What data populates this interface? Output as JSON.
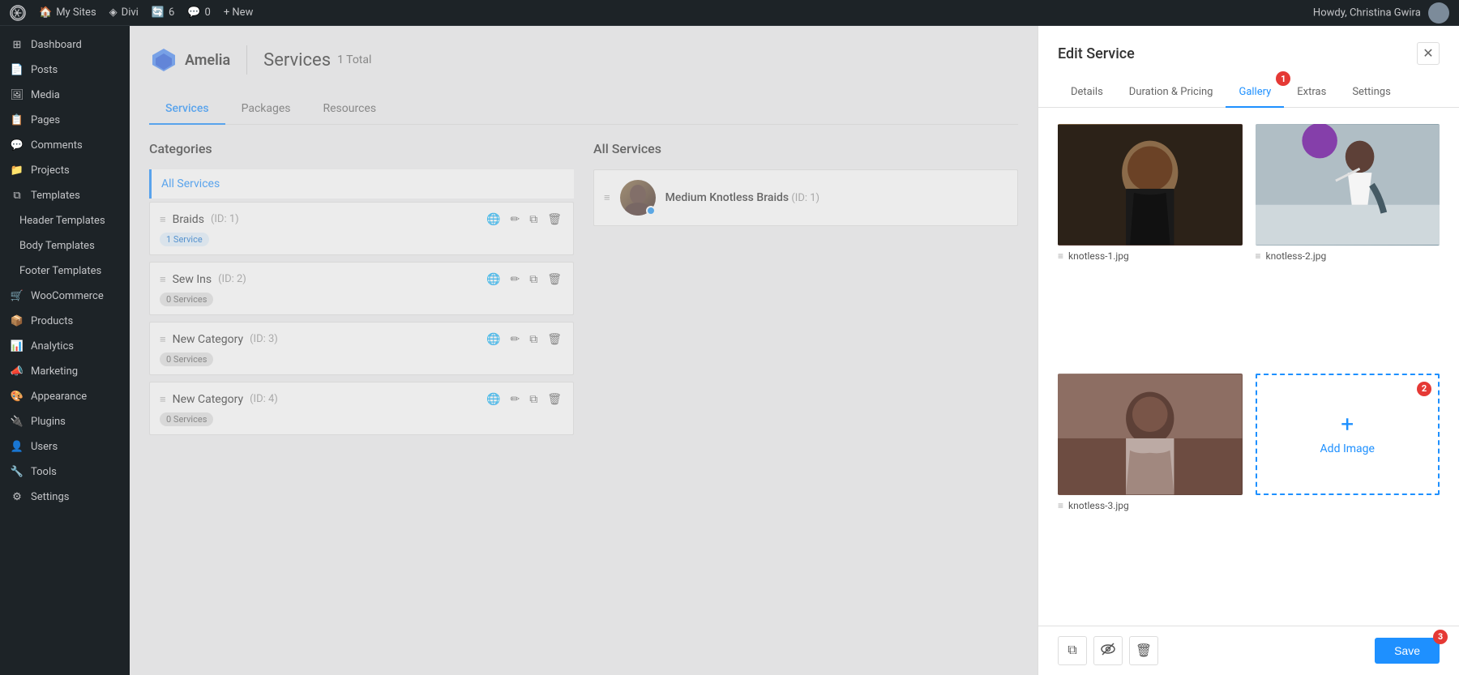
{
  "adminBar": {
    "wpIcon": "W",
    "mySites": "My Sites",
    "divi": "Divi",
    "updates": "6",
    "comments": "0",
    "new": "+ New",
    "greeting": "Howdy, Christina Gwira"
  },
  "sidebar": {
    "items": [
      {
        "id": "dashboard",
        "label": "Dashboard",
        "icon": "⊞"
      },
      {
        "id": "posts",
        "label": "Posts",
        "icon": "📄"
      },
      {
        "id": "media",
        "label": "Media",
        "icon": "🖼"
      },
      {
        "id": "pages",
        "label": "Pages",
        "icon": "📋"
      },
      {
        "id": "comments",
        "label": "Comments",
        "icon": "💬"
      },
      {
        "id": "projects",
        "label": "Projects",
        "icon": "📁"
      },
      {
        "id": "templates",
        "label": "Templates",
        "icon": "⧉"
      },
      {
        "id": "header-templates",
        "label": "Header Templates",
        "icon": ""
      },
      {
        "id": "body-templates",
        "label": "Body Templates",
        "icon": ""
      },
      {
        "id": "footer-templates",
        "label": "Footer Templates",
        "icon": ""
      },
      {
        "id": "woocommerce",
        "label": "WooCommerce",
        "icon": "🛒"
      },
      {
        "id": "products",
        "label": "Products",
        "icon": "📦"
      },
      {
        "id": "analytics",
        "label": "Analytics",
        "icon": "📊"
      },
      {
        "id": "marketing",
        "label": "Marketing",
        "icon": "📣"
      },
      {
        "id": "appearance",
        "label": "Appearance",
        "icon": "🎨"
      },
      {
        "id": "plugins",
        "label": "Plugins",
        "icon": "🔌"
      },
      {
        "id": "users",
        "label": "Users",
        "icon": "👤"
      },
      {
        "id": "tools",
        "label": "Tools",
        "icon": "🔧"
      },
      {
        "id": "settings",
        "label": "Settings",
        "icon": "⚙"
      }
    ]
  },
  "pageHeader": {
    "appName": "Amelia",
    "pageTitle": "Services",
    "countLabel": "1",
    "totalLabel": "Total"
  },
  "tabs": [
    {
      "id": "services",
      "label": "Services",
      "active": true
    },
    {
      "id": "packages",
      "label": "Packages",
      "active": false
    },
    {
      "id": "resources",
      "label": "Resources",
      "active": false
    }
  ],
  "categories": {
    "title": "Categories",
    "allLabel": "All Services",
    "items": [
      {
        "id": 1,
        "name": "Braids",
        "serviceCount": "1 Service",
        "hasServices": true
      },
      {
        "id": 2,
        "name": "Sew Ins",
        "serviceCount": "0 Services",
        "hasServices": false
      },
      {
        "id": 3,
        "name": "New Category",
        "serviceCount": "0 Services",
        "hasServices": false
      },
      {
        "id": 4,
        "name": "New Category",
        "serviceCount": "0 Services",
        "hasServices": false
      }
    ]
  },
  "allServices": {
    "title": "All Services",
    "items": [
      {
        "id": 1,
        "name": "Medium Knotless Braids",
        "idLabel": "(ID: 1)"
      }
    ]
  },
  "editPanel": {
    "title": "Edit Service",
    "tabs": [
      {
        "id": "details",
        "label": "Details",
        "active": false
      },
      {
        "id": "duration-pricing",
        "label": "Duration & Pricing",
        "active": false
      },
      {
        "id": "gallery",
        "label": "Gallery",
        "active": true,
        "badge": "1"
      },
      {
        "id": "extras",
        "label": "Extras",
        "active": false
      },
      {
        "id": "settings",
        "label": "Settings",
        "active": false
      }
    ],
    "gallery": {
      "images": [
        {
          "id": 1,
          "filename": "knotless-1.jpg"
        },
        {
          "id": 2,
          "filename": "knotless-2.jpg"
        },
        {
          "id": 3,
          "filename": "knotless-3.jpg"
        }
      ],
      "addImageLabel": "Add Image",
      "badge": "2"
    },
    "footer": {
      "duplicateIcon": "⧉",
      "hideIcon": "◎",
      "deleteIcon": "🗑",
      "saveLabel": "Save",
      "saveBadge": "3"
    }
  }
}
